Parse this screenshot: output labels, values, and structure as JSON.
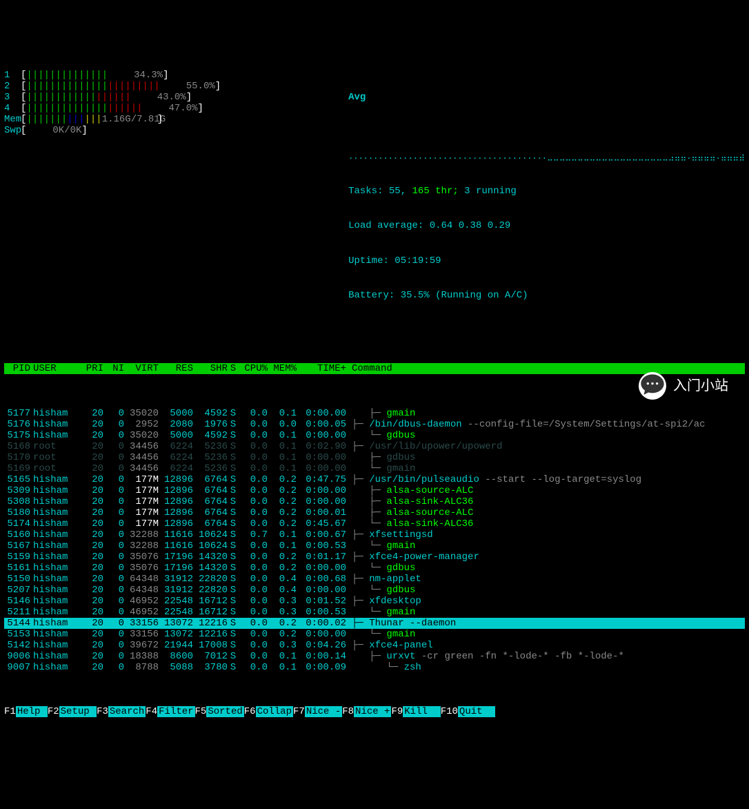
{
  "cpus": [
    {
      "id": "1",
      "greens": 14,
      "reds": 0,
      "blues": 0,
      "pct": "34.3%"
    },
    {
      "id": "2",
      "greens": 14,
      "reds": 9,
      "blues": 0,
      "pct": "55.0%"
    },
    {
      "id": "3",
      "greens": 12,
      "reds": 6,
      "blues": 0,
      "pct": "43.0%"
    },
    {
      "id": "4",
      "greens": 14,
      "reds": 6,
      "blues": 0,
      "pct": "47.0%"
    }
  ],
  "mem": {
    "label": "Mem",
    "greens": 7,
    "blues": 3,
    "yellows": 3,
    "text": "1.16G/7.81G"
  },
  "swp": {
    "label": "Swp",
    "text": "0K/0K"
  },
  "avg_label": "Avg",
  "graph": "........................................⣀⣀⣀⣀⣀⣀⣀⣀⣀⣀⣀⣀⣀⣀⣀⣀⣀⣀⣀⣀⣠⣤⣤.⣤⣤⣤⣤.⣤⣤⣤⣴",
  "tasks": {
    "label": "Tasks:",
    "procs": "55,",
    "threads": "165 thr;",
    "running": "3 running"
  },
  "load": {
    "label": "Load average:",
    "vals": "0.64 0.38 0.29"
  },
  "uptime": {
    "label": "Uptime:",
    "val": "05:19:59"
  },
  "battery": {
    "label": "Battery:",
    "val": "35.5% (Running on A/C)"
  },
  "columns": [
    "PID",
    "USER",
    "PRI",
    "NI",
    "VIRT",
    "RES",
    "SHR",
    "S",
    "CPU%",
    "MEM%",
    "TIME+",
    "Command"
  ],
  "processes": [
    {
      "pid": "5177",
      "user": "hisham",
      "pri": "20",
      "ni": "0",
      "virt": "35020",
      "res": "5000",
      "shr": "4592",
      "s": "S",
      "cpu": "0.0",
      "mem": "0.1",
      "time": "0:00.00",
      "cmd_prefix": "   ├─ ",
      "cmd": "gmain",
      "cmd_class": "green",
      "virt_class": "grey"
    },
    {
      "pid": "5176",
      "user": "hisham",
      "pri": "20",
      "ni": "0",
      "virt": "2952",
      "res": "2080",
      "shr": "1976",
      "s": "S",
      "cpu": "0.0",
      "mem": "0.0",
      "time": "0:00.05",
      "cmd_prefix": "├─ ",
      "cmd": "/bin/dbus-daemon",
      "cmd_args": " --config-file=/System/Settings/at-spi2/ac",
      "cmd_class": "cyan",
      "virt_class": "grey"
    },
    {
      "pid": "5175",
      "user": "hisham",
      "pri": "20",
      "ni": "0",
      "virt": "35020",
      "res": "5000",
      "shr": "4592",
      "s": "S",
      "cpu": "0.0",
      "mem": "0.1",
      "time": "0:00.00",
      "cmd_prefix": "   └─ ",
      "cmd": "gdbus",
      "cmd_class": "green",
      "virt_class": "grey"
    },
    {
      "pid": "5168",
      "user": "root",
      "pri": "20",
      "ni": "0",
      "virt": "34456",
      "res": "6224",
      "shr": "5236",
      "s": "S",
      "cpu": "0.0",
      "mem": "0.1",
      "time": "0:02.90",
      "cmd_prefix": "├─ ",
      "cmd": "/usr/lib/upower/upowerd",
      "dim": true
    },
    {
      "pid": "5170",
      "user": "root",
      "pri": "20",
      "ni": "0",
      "virt": "34456",
      "res": "6224",
      "shr": "5236",
      "s": "S",
      "cpu": "0.0",
      "mem": "0.1",
      "time": "0:00.00",
      "cmd_prefix": "   ├─ ",
      "cmd": "gdbus",
      "dim": true
    },
    {
      "pid": "5169",
      "user": "root",
      "pri": "20",
      "ni": "0",
      "virt": "34456",
      "res": "6224",
      "shr": "5236",
      "s": "S",
      "cpu": "0.0",
      "mem": "0.1",
      "time": "0:00.00",
      "cmd_prefix": "   └─ ",
      "cmd": "gmain",
      "dim": true
    },
    {
      "pid": "5165",
      "user": "hisham",
      "pri": "20",
      "ni": "0",
      "virt": "177M",
      "res": "12896",
      "shr": "6764",
      "s": "S",
      "cpu": "0.0",
      "mem": "0.2",
      "time": "0:47.75",
      "cmd_prefix": "├─ ",
      "cmd": "/usr/bin/pulseaudio",
      "cmd_args": " --start --log-target=syslog",
      "cmd_class": "cyan",
      "virt_class": "white"
    },
    {
      "pid": "5309",
      "user": "hisham",
      "pri": "20",
      "ni": "0",
      "virt": "177M",
      "res": "12896",
      "shr": "6764",
      "s": "S",
      "cpu": "0.0",
      "mem": "0.2",
      "time": "0:00.00",
      "cmd_prefix": "   ├─ ",
      "cmd": "alsa-source-ALC",
      "cmd_class": "green",
      "virt_class": "white"
    },
    {
      "pid": "5308",
      "user": "hisham",
      "pri": "20",
      "ni": "0",
      "virt": "177M",
      "res": "12896",
      "shr": "6764",
      "s": "S",
      "cpu": "0.0",
      "mem": "0.2",
      "time": "0:00.00",
      "cmd_prefix": "   ├─ ",
      "cmd": "alsa-sink-ALC36",
      "cmd_class": "green",
      "virt_class": "white"
    },
    {
      "pid": "5180",
      "user": "hisham",
      "pri": "20",
      "ni": "0",
      "virt": "177M",
      "res": "12896",
      "shr": "6764",
      "s": "S",
      "cpu": "0.0",
      "mem": "0.2",
      "time": "0:00.01",
      "cmd_prefix": "   ├─ ",
      "cmd": "alsa-source-ALC",
      "cmd_class": "green",
      "virt_class": "white"
    },
    {
      "pid": "5174",
      "user": "hisham",
      "pri": "20",
      "ni": "0",
      "virt": "177M",
      "res": "12896",
      "shr": "6764",
      "s": "S",
      "cpu": "0.0",
      "mem": "0.2",
      "time": "0:45.67",
      "cmd_prefix": "   └─ ",
      "cmd": "alsa-sink-ALC36",
      "cmd_class": "green",
      "virt_class": "white"
    },
    {
      "pid": "5160",
      "user": "hisham",
      "pri": "20",
      "ni": "0",
      "virt": "32288",
      "res": "11616",
      "shr": "10624",
      "s": "S",
      "cpu": "0.7",
      "mem": "0.1",
      "time": "0:00.67",
      "cmd_prefix": "├─ ",
      "cmd": "xfsettingsd",
      "cmd_class": "cyan",
      "virt_class": "grey"
    },
    {
      "pid": "5167",
      "user": "hisham",
      "pri": "20",
      "ni": "0",
      "virt": "32288",
      "res": "11616",
      "shr": "10624",
      "s": "S",
      "cpu": "0.0",
      "mem": "0.1",
      "time": "0:00.53",
      "cmd_prefix": "   └─ ",
      "cmd": "gmain",
      "cmd_class": "green",
      "virt_class": "grey"
    },
    {
      "pid": "5159",
      "user": "hisham",
      "pri": "20",
      "ni": "0",
      "virt": "35076",
      "res": "17196",
      "shr": "14320",
      "s": "S",
      "cpu": "0.0",
      "mem": "0.2",
      "time": "0:01.17",
      "cmd_prefix": "├─ ",
      "cmd": "xfce4-power-manager",
      "cmd_class": "cyan",
      "virt_class": "grey"
    },
    {
      "pid": "5161",
      "user": "hisham",
      "pri": "20",
      "ni": "0",
      "virt": "35076",
      "res": "17196",
      "shr": "14320",
      "s": "S",
      "cpu": "0.0",
      "mem": "0.2",
      "time": "0:00.00",
      "cmd_prefix": "   └─ ",
      "cmd": "gdbus",
      "cmd_class": "green",
      "virt_class": "grey"
    },
    {
      "pid": "5150",
      "user": "hisham",
      "pri": "20",
      "ni": "0",
      "virt": "64348",
      "res": "31912",
      "shr": "22820",
      "s": "S",
      "cpu": "0.0",
      "mem": "0.4",
      "time": "0:00.68",
      "cmd_prefix": "├─ ",
      "cmd": "nm-applet",
      "cmd_class": "cyan",
      "virt_class": "grey"
    },
    {
      "pid": "5207",
      "user": "hisham",
      "pri": "20",
      "ni": "0",
      "virt": "64348",
      "res": "31912",
      "shr": "22820",
      "s": "S",
      "cpu": "0.0",
      "mem": "0.4",
      "time": "0:00.00",
      "cmd_prefix": "   └─ ",
      "cmd": "gdbus",
      "cmd_class": "green",
      "virt_class": "grey"
    },
    {
      "pid": "5146",
      "user": "hisham",
      "pri": "20",
      "ni": "0",
      "virt": "46952",
      "res": "22548",
      "shr": "16712",
      "s": "S",
      "cpu": "0.0",
      "mem": "0.3",
      "time": "0:01.52",
      "cmd_prefix": "├─ ",
      "cmd": "xfdesktop",
      "cmd_class": "cyan",
      "virt_class": "grey"
    },
    {
      "pid": "5211",
      "user": "hisham",
      "pri": "20",
      "ni": "0",
      "virt": "46952",
      "res": "22548",
      "shr": "16712",
      "s": "S",
      "cpu": "0.0",
      "mem": "0.3",
      "time": "0:00.53",
      "cmd_prefix": "   └─ ",
      "cmd": "gmain",
      "cmd_class": "green",
      "virt_class": "grey"
    },
    {
      "pid": "5144",
      "user": "hisham",
      "pri": "20",
      "ni": "0",
      "virt": "33156",
      "res": "13072",
      "shr": "12216",
      "s": "S",
      "cpu": "0.0",
      "mem": "0.2",
      "time": "0:00.02",
      "cmd_prefix": "├─ ",
      "cmd": "Thunar",
      "cmd_args": " --daemon",
      "selected": true
    },
    {
      "pid": "5153",
      "user": "hisham",
      "pri": "20",
      "ni": "0",
      "virt": "33156",
      "res": "13072",
      "shr": "12216",
      "s": "S",
      "cpu": "0.0",
      "mem": "0.2",
      "time": "0:00.00",
      "cmd_prefix": "   └─ ",
      "cmd": "gmain",
      "cmd_class": "green",
      "virt_class": "grey"
    },
    {
      "pid": "5142",
      "user": "hisham",
      "pri": "20",
      "ni": "0",
      "virt": "39672",
      "res": "21944",
      "shr": "17008",
      "s": "S",
      "cpu": "0.0",
      "mem": "0.3",
      "time": "0:04.26",
      "cmd_prefix": "├─ ",
      "cmd": "xfce4-panel",
      "cmd_class": "cyan",
      "virt_class": "grey"
    },
    {
      "pid": "9006",
      "user": "hisham",
      "pri": "20",
      "ni": "0",
      "virt": "18388",
      "res": "8600",
      "shr": "7012",
      "s": "S",
      "cpu": "0.0",
      "mem": "0.1",
      "time": "0:00.14",
      "cmd_prefix": "   ├─ ",
      "cmd": "urxvt",
      "cmd_args": " -cr green -fn *-lode-* -fb *-lode-*",
      "cmd_class": "cyan",
      "virt_class": "grey"
    },
    {
      "pid": "9007",
      "user": "hisham",
      "pri": "20",
      "ni": "0",
      "virt": "8788",
      "res": "5088",
      "shr": "3780",
      "s": "S",
      "cpu": "0.0",
      "mem": "0.1",
      "time": "0:00.09",
      "cmd_prefix": "      └─ ",
      "cmd": "zsh",
      "cmd_class": "cyan",
      "virt_class": "grey"
    }
  ],
  "fkeys": [
    {
      "key": "F1",
      "label": "Help "
    },
    {
      "key": "F2",
      "label": "Setup "
    },
    {
      "key": "F3",
      "label": "Search"
    },
    {
      "key": "F4",
      "label": "Filter"
    },
    {
      "key": "F5",
      "label": "Sorted"
    },
    {
      "key": "F6",
      "label": "Collap"
    },
    {
      "key": "F7",
      "label": "Nice -"
    },
    {
      "key": "F8",
      "label": "Nice +"
    },
    {
      "key": "F9",
      "label": "Kill  "
    },
    {
      "key": "F10",
      "label": "Quit  "
    }
  ],
  "watermark": "入门小站"
}
